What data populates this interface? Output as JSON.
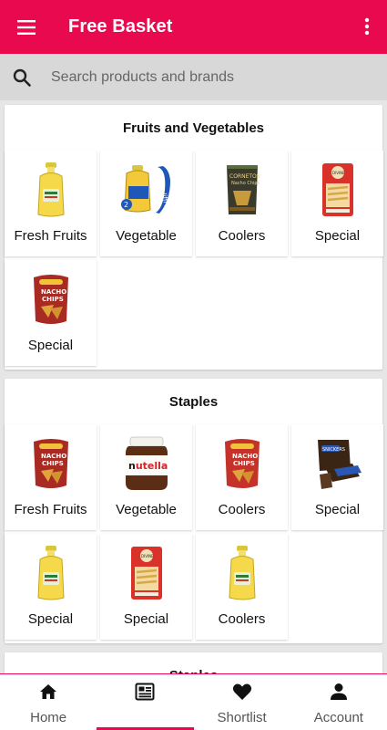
{
  "appbar": {
    "title": "Free Basket",
    "menu_icon": "hamburger-menu-icon",
    "more_icon": "more-vert-icon",
    "color": "#e8094f"
  },
  "search": {
    "placeholder": "Search products and brands",
    "icon": "search-icon"
  },
  "sections": [
    {
      "title": "Fruits and Vegetables",
      "items": [
        {
          "label": "Fresh Fruits",
          "image": "oil-bottle"
        },
        {
          "label": "Vegetable",
          "image": "oil-bottle-pack"
        },
        {
          "label": "Coolers",
          "image": "chips-bag-dark"
        },
        {
          "label": "Special",
          "image": "pasta-pack"
        },
        {
          "label": "Special",
          "image": "nacho-chips"
        }
      ]
    },
    {
      "title": "Staples",
      "items": [
        {
          "label": "Fresh Fruits",
          "image": "nacho-chips"
        },
        {
          "label": "Vegetable",
          "image": "nutella-jar"
        },
        {
          "label": "Coolers",
          "image": "nacho-chips"
        },
        {
          "label": "Special",
          "image": "chocolate-pack"
        },
        {
          "label": "Special",
          "image": "oil-bottle"
        },
        {
          "label": "Special",
          "image": "pasta-pack"
        },
        {
          "label": "Coolers",
          "image": "oil-bottle"
        }
      ]
    },
    {
      "title": "Staples"
    }
  ],
  "bottom_nav": [
    {
      "label": "Home",
      "icon": "home-icon"
    },
    {
      "label": "",
      "icon": "orders-icon",
      "active": true
    },
    {
      "label": "Shortlist",
      "icon": "heart-icon"
    },
    {
      "label": "Account",
      "icon": "person-icon"
    }
  ]
}
